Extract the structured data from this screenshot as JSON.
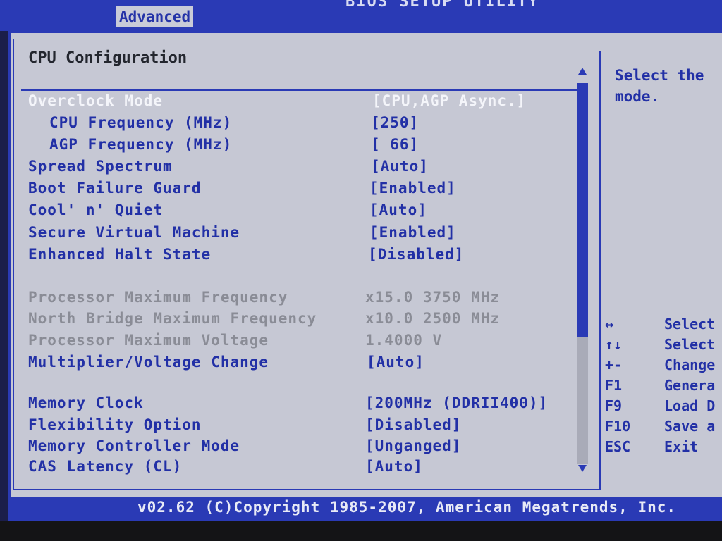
{
  "app": {
    "title": "BIOS SETUP UTILITY",
    "active_tab": "Advanced"
  },
  "section": {
    "title": "CPU Configuration"
  },
  "settings": [
    {
      "label": "Overclock Mode",
      "value": "[CPU,AGP Async.]",
      "state": "selected"
    },
    {
      "label": "CPU Frequency (MHz)",
      "value": "[250]",
      "state": "sub"
    },
    {
      "label": "AGP Frequency (MHz)",
      "value": "[ 66]",
      "state": "sub"
    },
    {
      "label": "Spread Spectrum",
      "value": "[Auto]",
      "state": "normal"
    },
    {
      "label": "Boot Failure Guard",
      "value": "[Enabled]",
      "state": "normal"
    },
    {
      "label": "Cool' n' Quiet",
      "value": "[Auto]",
      "state": "normal"
    },
    {
      "label": "Secure Virtual Machine",
      "value": "[Enabled]",
      "state": "normal"
    },
    {
      "label": "Enhanced Halt State",
      "value": "[Disabled]",
      "state": "normal"
    },
    {
      "label": "Processor Maximum Frequency",
      "value": "x15.0 3750 MHz",
      "state": "readonly"
    },
    {
      "label": "North Bridge Maximum Frequency",
      "value": "x10.0 2500 MHz",
      "state": "readonly"
    },
    {
      "label": "Processor Maximum Voltage",
      "value": "1.4000 V",
      "state": "readonly"
    },
    {
      "label": "Multiplier/Voltage Change",
      "value": "[Auto]",
      "state": "normal"
    },
    {
      "label": "Memory Clock",
      "value": "[200MHz (DDRII400)]",
      "state": "normal"
    },
    {
      "label": "Flexibility Option",
      "value": "[Disabled]",
      "state": "normal"
    },
    {
      "label": "Memory Controller Mode",
      "value": "[Unganged]",
      "state": "normal"
    },
    {
      "label": "CAS Latency (CL)",
      "value": "[Auto]",
      "state": "normal"
    }
  ],
  "help": {
    "text": "Select the\nmode."
  },
  "keys": [
    {
      "key": "↔",
      "desc": "Select"
    },
    {
      "key": "↑↓",
      "desc": "Select"
    },
    {
      "key": "+-",
      "desc": "Change"
    },
    {
      "key": "F1",
      "desc": "Genera"
    },
    {
      "key": "F9",
      "desc": "Load D"
    },
    {
      "key": "F10",
      "desc": "Save a"
    },
    {
      "key": "ESC",
      "desc": "Exit"
    }
  ],
  "footer": {
    "copyright": "v02.62 (C)Copyright 1985-2007, American Megatrends, Inc."
  },
  "colors": {
    "bios_blue": "#2a3ab5",
    "panel_gray": "#c6c8d4",
    "text_blue": "#2230a6",
    "selected_white": "#f4f5fa",
    "readonly_gray": "#8a8c96"
  }
}
